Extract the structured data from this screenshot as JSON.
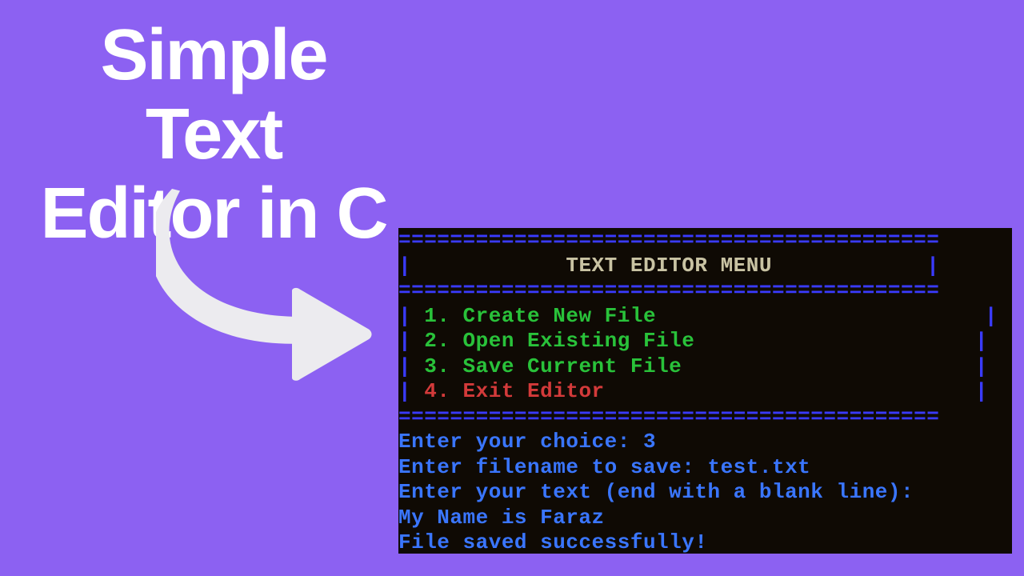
{
  "headline_line1": "Simple Text",
  "headline_line2": "Editor in C",
  "terminal": {
    "ruler_text": "==========================================",
    "pipe": "|",
    "menu_title": "TEXT EDITOR MENU",
    "options": {
      "n1": " 1. ",
      "t1": "Create New File",
      "n2": " 2. ",
      "t2": "Open Existing File",
      "n3": " 3. ",
      "t3": "Save Current File",
      "n4": " 4. ",
      "t4": "Exit Editor"
    },
    "prompts": {
      "choice_label": "Enter your choice: ",
      "choice_value": "3",
      "filename_label": "Enter filename to save: ",
      "filename_value": "test.txt",
      "entertext": "Enter your text (end with a blank line):",
      "content": "My Name is Faraz",
      "status": "File saved successfully!"
    }
  }
}
